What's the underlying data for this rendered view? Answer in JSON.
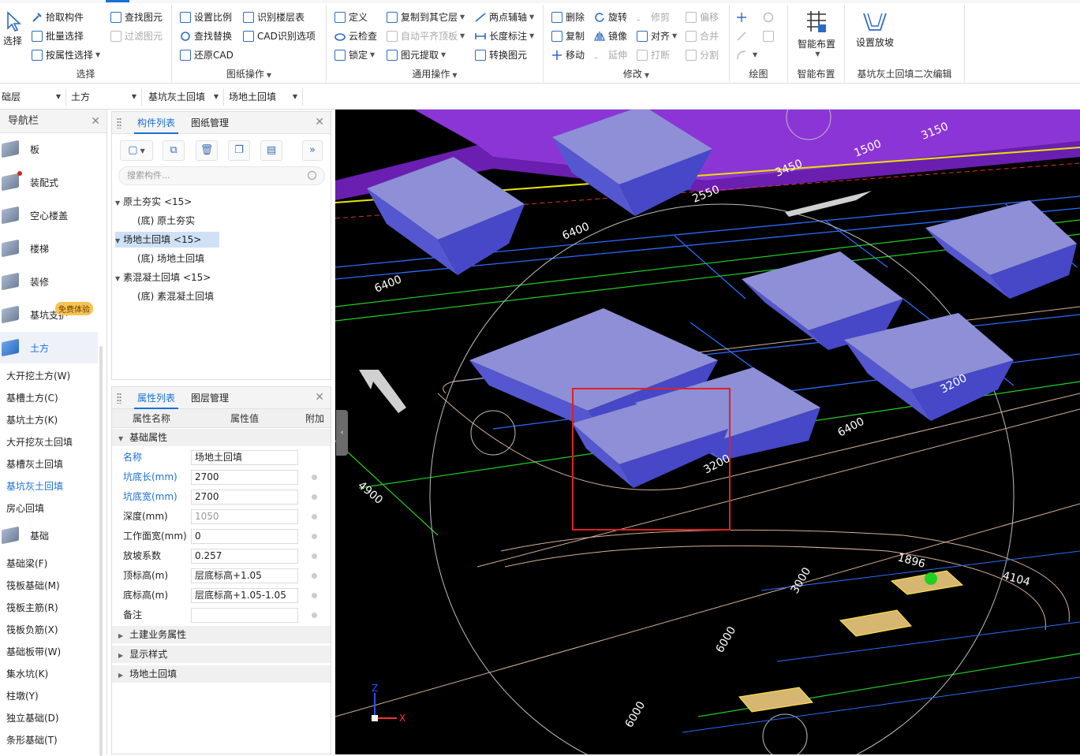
{
  "ribbon": {
    "select_group": {
      "select": "选择",
      "pick": "拾取构件",
      "batch": "批量选择",
      "by_attr": "按属性选择",
      "find": "查找图元",
      "filter": "过滤图元",
      "label": "选择"
    },
    "drawing_ops": {
      "set_scale": "设置比例",
      "identify_layers": "识别楼层表",
      "find_replace": "查找替换",
      "cad_options": "CAD识别选项",
      "restore_cad": "还原CAD",
      "label": "图纸操作"
    },
    "general_ops": {
      "define": "定义",
      "copy_to_other": "复制到其它层",
      "two_point_axis": "两点辅轴",
      "cloud_check": "云检查",
      "auto_align": "自动平齐顶板",
      "length_dim": "长度标注",
      "lock": "锁定",
      "extract": "图元提取",
      "convert": "转换图元",
      "label": "通用操作"
    },
    "modify": {
      "delete": "删除",
      "rotate": "旋转",
      "trim": "修剪",
      "offset": "偏移",
      "copy": "复制",
      "mirror": "镜像",
      "align": "对齐",
      "merge": "合并",
      "move": "移动",
      "extend": "延伸",
      "break": "打断",
      "split": "分割",
      "label": "修改"
    },
    "draw": {
      "label": "绘图"
    },
    "smart": {
      "button": "智能布置",
      "label": "智能布置"
    },
    "slope": {
      "button": "设置放坡",
      "label": "基坑灰土回填二次编辑"
    }
  },
  "combos": [
    "础层",
    "土方",
    "基坑灰土回填",
    "场地土回填"
  ],
  "nav": {
    "title": "导航栏",
    "items": [
      "板",
      "装配式",
      "空心楼盖",
      "楼梯",
      "装修",
      "基坑支护",
      "土方"
    ],
    "badge": "免费体验",
    "earth_subs": [
      "大开挖土方(W)",
      "基槽土方(C)",
      "基坑土方(K)",
      "大开挖灰土回填",
      "基槽灰土回填",
      "基坑灰土回填",
      "房心回填"
    ],
    "foundation": "基础",
    "foundation_subs": [
      "基础梁(F)",
      "筏板基础(M)",
      "筏板主筋(R)",
      "筏板负筋(X)",
      "基础板带(W)",
      "集水坑(K)",
      "柱墩(Y)",
      "独立基础(D)",
      "条形基础(T)"
    ]
  },
  "component_panel": {
    "tabs": [
      "构件列表",
      "图纸管理"
    ],
    "search_placeholder": "搜索构件...",
    "tree": [
      {
        "label": "原土夯实 <15>",
        "child": "(底) 原土夯实"
      },
      {
        "label": "场地土回填 <15>",
        "child": "(底) 场地土回填"
      },
      {
        "label": "素混凝土回填 <15>",
        "child": "(底) 素混凝土回填"
      }
    ]
  },
  "property_panel": {
    "tabs": [
      "属性列表",
      "图层管理"
    ],
    "headers": {
      "name": "属性名称",
      "value": "属性值",
      "extra": "附加"
    },
    "section": "基础属性",
    "rows": [
      {
        "name": "名称",
        "value": "场地土回填"
      },
      {
        "name": "坑底长(mm)",
        "value": "2700"
      },
      {
        "name": "坑底宽(mm)",
        "value": "2700"
      },
      {
        "name": "深度(mm)",
        "value": "1050"
      },
      {
        "name": "工作面宽(mm)",
        "value": "0"
      },
      {
        "name": "放坡系数",
        "value": "0.257"
      },
      {
        "name": "顶标高(m)",
        "value": "层底标高+1.05"
      },
      {
        "name": "底标高(m)",
        "value": "层底标高+1.05-1.05"
      },
      {
        "name": "备注",
        "value": ""
      }
    ],
    "collapsed": [
      "土建业务属性",
      "显示样式",
      "场地土回填"
    ]
  },
  "canvas": {
    "dims": [
      "3150",
      "1500",
      "3450",
      "2550",
      "6400",
      "6400",
      "6400",
      "3200",
      "3200",
      "4900",
      "1896",
      "4104",
      "3000",
      "6000",
      "6000"
    ],
    "axis": {
      "z": "Z",
      "x": "X"
    }
  }
}
